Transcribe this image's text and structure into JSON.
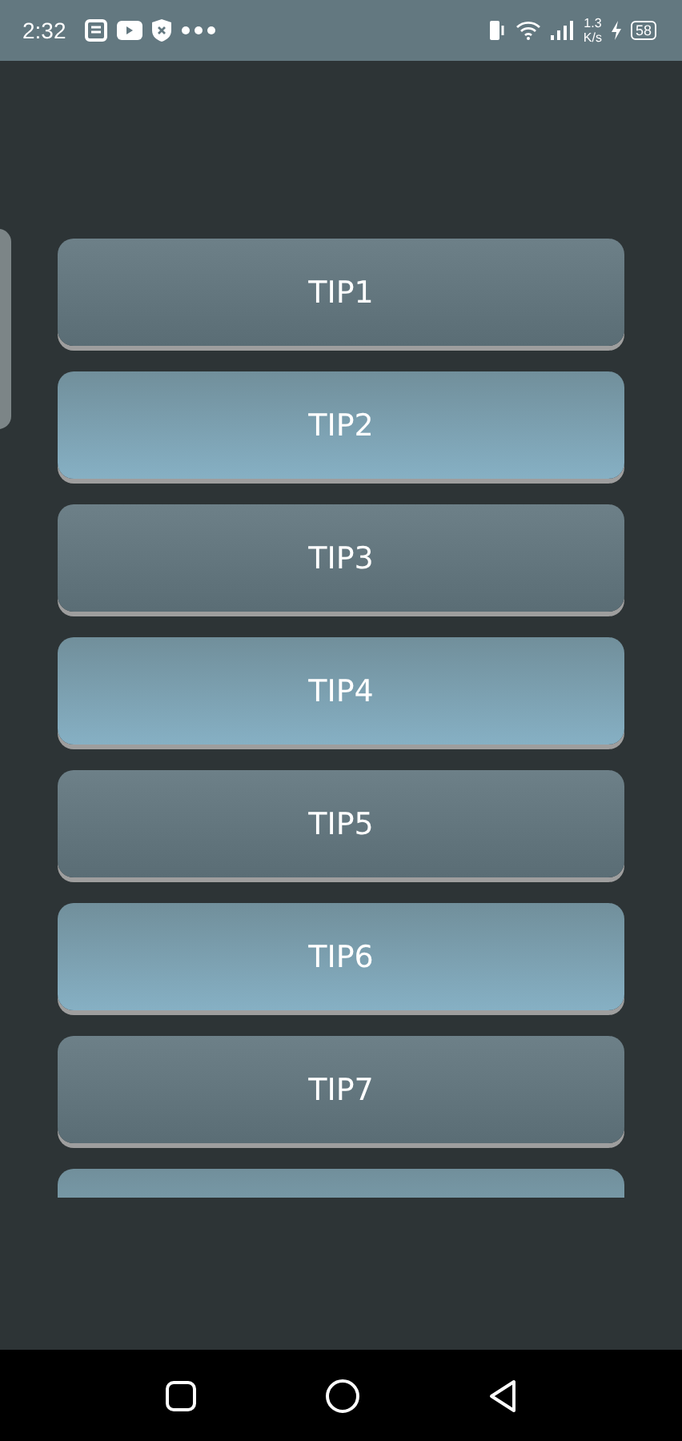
{
  "status_bar": {
    "time": "2:32",
    "speed_value": "1.3",
    "speed_unit": "K/s",
    "battery": "58"
  },
  "tips": [
    {
      "label": "TIP1",
      "kind": "dark"
    },
    {
      "label": "TIP2",
      "kind": "light"
    },
    {
      "label": "TIP3",
      "kind": "dark"
    },
    {
      "label": "TIP4",
      "kind": "light"
    },
    {
      "label": "TIP5",
      "kind": "dark"
    },
    {
      "label": "TIP6",
      "kind": "light"
    },
    {
      "label": "TIP7",
      "kind": "dark"
    },
    {
      "kind": "light"
    }
  ]
}
